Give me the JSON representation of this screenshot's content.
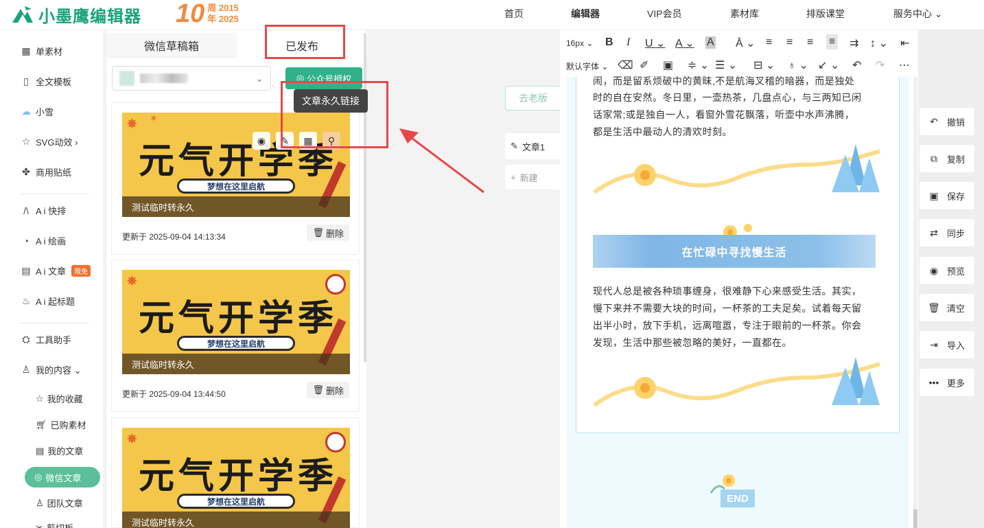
{
  "brand": {
    "name": "小墨鹰编辑器",
    "anniv_number": "10",
    "anniv_line1": "周 2015",
    "anniv_line2": "年 2025"
  },
  "nav": [
    "首页",
    "编辑器",
    "VIP会员",
    "素材库",
    "排版课堂",
    "服务中心 ⌄"
  ],
  "sidebar": {
    "items": [
      {
        "label": "单素材",
        "icon": "grid-icon"
      },
      {
        "label": "全文模板",
        "icon": "template-icon"
      },
      {
        "label": "小雪",
        "icon": "cloud-icon"
      },
      {
        "label": "SVG动效 ›",
        "icon": "star-icon"
      },
      {
        "label": "商用贴纸",
        "icon": "puzzle-icon"
      },
      {
        "label": "A i 快排",
        "icon": "ai-icon"
      },
      {
        "label": "A i 绘画",
        "icon": "palette-icon"
      },
      {
        "label": "A i 文章",
        "icon": "doc-icon",
        "badge": "限免"
      },
      {
        "label": "A i 起标题",
        "icon": "fire-icon"
      },
      {
        "label": "工具助手",
        "icon": "tool-icon"
      },
      {
        "label": "我的内容 ⌄",
        "icon": "user-icon"
      }
    ],
    "sub_items": [
      {
        "label": "我的收藏",
        "icon": "star-icon"
      },
      {
        "label": "已购素材",
        "icon": "cart-icon"
      },
      {
        "label": "我的文章",
        "icon": "doc-icon"
      },
      {
        "label": "微信文章",
        "icon": "wechat-icon",
        "active": true
      },
      {
        "label": "团队文章",
        "icon": "team-icon"
      },
      {
        "label": "剪切板",
        "icon": "clip-icon"
      }
    ]
  },
  "panel": {
    "tab_draft": "微信草稿箱",
    "tab_published": "已发布",
    "auth_button": "公众号授权",
    "tooltip": "文章永久链接",
    "cards": [
      {
        "title": "元气开学季",
        "subtitle": "梦想在这里启航",
        "caption": "测试临时转永久",
        "updated": "更新于 2025-09-04 14:13:34",
        "delete": "删除"
      },
      {
        "title": "元气开学季",
        "subtitle": "梦想在这里启航",
        "caption": "测试临时转永久",
        "updated": "更新于 2025-09-04 13:44:50",
        "delete": "删除"
      },
      {
        "title": "元气开学季",
        "subtitle": "梦想在这里启航",
        "caption": "测试临时转永久",
        "updated": "",
        "delete": ""
      }
    ]
  },
  "middle": {
    "revert_button": "去老版",
    "article_tab": "文章1",
    "new_button": "新建"
  },
  "toolbar": {
    "font_size": "16px",
    "font_family": "默认字体"
  },
  "doc": {
    "para1": [
      "闹，而是留系烦破中的黄昧,不是航海叉稽的暗器，而是独处",
      "时的自在安然。冬日里，一壶热茶，几盘点心，与三两知已闲",
      "话家常;或是独自一人，看窗外雪花飘落，听壶中水声沸腾，",
      "都是生活中最动人的清欢时刻。"
    ],
    "banner": "在忙碌中寻找慢生活",
    "para2": [
      "现代人总是被各种琐事缠身，很难静下心来感受生活。其实，",
      "慢下来并不需要大块的时间，一杯茶的工夫足矣。试着每天留",
      "出半小时，放下手机，远离喧嚣，专注于眼前的一杯茶。你会",
      "发现，生活中那些被忽略的美好，一直都在。"
    ],
    "end": "END"
  },
  "actions": [
    "撤销",
    "复制",
    "保存",
    "同步",
    "预览",
    "清空",
    "导入",
    "更多"
  ],
  "colors": {
    "brand": "#1aa37a",
    "accent": "#2fb28a",
    "annotation": "#e8474a"
  }
}
